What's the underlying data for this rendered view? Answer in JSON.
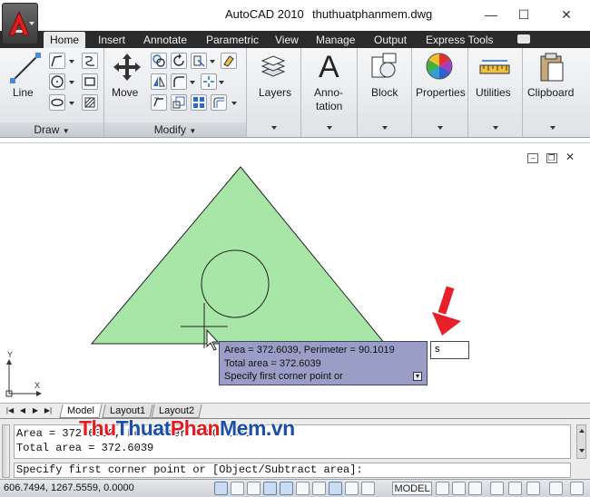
{
  "window": {
    "app_title": "AutoCAD 2010",
    "file_name": "thuthuatphanmem.dwg",
    "minimize_glyph": "—",
    "maximize_glyph": "☐",
    "close_glyph": "✕"
  },
  "ribbon_tabs": [
    {
      "label": "Home",
      "active": true
    },
    {
      "label": "Insert"
    },
    {
      "label": "Annotate"
    },
    {
      "label": "Parametric"
    },
    {
      "label": "View"
    },
    {
      "label": "Manage"
    },
    {
      "label": "Output"
    },
    {
      "label": "Express Tools"
    }
  ],
  "ribbon": {
    "draw_panel": {
      "title": "Draw",
      "big_button": "Line"
    },
    "modify_panel": {
      "title": "Modify",
      "big_button": "Move"
    },
    "layers": "Layers",
    "annotation_line1": "Anno-",
    "annotation_line2": "tation",
    "block": "Block",
    "properties": "Properties",
    "utilities": "Utilities",
    "clipboard": "Clipboard"
  },
  "viewport": {
    "ucs_x": "X",
    "ucs_y": "Y",
    "tooltip": {
      "line1": "Area = 372.6039, Perimeter = 90.1019",
      "line2": "Total area = 372.6039",
      "line3": "Specify first corner point or"
    },
    "dynamic_input_value": "s"
  },
  "layout_tabs": [
    {
      "label": "Model",
      "active": true
    },
    {
      "label": "Layout1"
    },
    {
      "label": "Layout2"
    }
  ],
  "command_line": {
    "history_line1": "Area = 372.6039, Perimeter = 90.1019",
    "history_line2": "Total area = 372.6039",
    "prompt": "Specify first corner point or [Object/Subtract area]:"
  },
  "watermark": {
    "part1": "Thu",
    "part2": "Thuat",
    "part3": "Phan",
    "part4": "Mem",
    "part5": ".vn"
  },
  "status_bar": {
    "coordinates": "606.7494, 1267.5559, 0.0000",
    "model_label": "MODEL"
  },
  "colors": {
    "triangle_fill": "#a8e6a8",
    "tooltip_bg": "#9a9ec6",
    "annotation_arrow": "#e8202a",
    "tab_bar": "#2b2b2b"
  }
}
